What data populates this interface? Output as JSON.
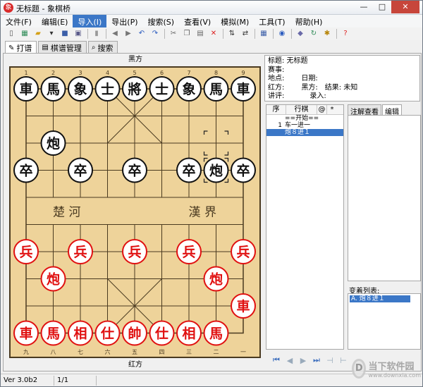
{
  "window": {
    "title": "无标题 - 象棋桥",
    "app_icon": "象",
    "min": "—",
    "max": "□",
    "close": "✕"
  },
  "menu": [
    "文件(F)",
    "编辑(E)",
    "导入(I)",
    "导出(P)",
    "搜索(S)",
    "查看(V)",
    "模拟(M)",
    "工具(T)",
    "帮助(H)"
  ],
  "toolbar": [
    {
      "name": "new-icon",
      "glyph": "▯",
      "color": "#555"
    },
    {
      "name": "board-icon",
      "glyph": "▦",
      "color": "#2e8b57"
    },
    {
      "name": "open-icon",
      "glyph": "▰",
      "color": "#d4a017"
    },
    {
      "name": "dropdown-icon",
      "glyph": "▾",
      "color": "#333"
    },
    {
      "name": "save-icon",
      "glyph": "■",
      "color": "#3b5ea8"
    },
    {
      "name": "save-as-icon",
      "glyph": "▣",
      "color": "#5a5a8a"
    },
    {
      "sep": true
    },
    {
      "name": "delete-icon",
      "glyph": "▮",
      "color": "#999"
    },
    {
      "sep": true
    },
    {
      "name": "back-icon",
      "glyph": "◀",
      "color": "#777"
    },
    {
      "name": "forward-icon",
      "glyph": "▶",
      "color": "#777"
    },
    {
      "name": "undo-icon",
      "glyph": "↶",
      "color": "#2a5bbf"
    },
    {
      "name": "redo-icon",
      "glyph": "↷",
      "color": "#2a5bbf"
    },
    {
      "sep": true
    },
    {
      "name": "cut-icon",
      "glyph": "✂",
      "color": "#666"
    },
    {
      "name": "copy-icon",
      "glyph": "❐",
      "color": "#666"
    },
    {
      "name": "paste-icon",
      "glyph": "▤",
      "color": "#666"
    },
    {
      "name": "clear-icon",
      "glyph": "✕",
      "color": "#d22"
    },
    {
      "sep": true
    },
    {
      "name": "sort-icon",
      "glyph": "⇅",
      "color": "#333"
    },
    {
      "name": "swap-icon",
      "glyph": "⇄",
      "color": "#333"
    },
    {
      "sep": true
    },
    {
      "name": "layout-icon",
      "glyph": "▦",
      "color": "#3b5ea8"
    },
    {
      "sep": true
    },
    {
      "name": "play-icon",
      "glyph": "◉",
      "color": "#2a5bbf"
    },
    {
      "sep": true
    },
    {
      "name": "tag-icon",
      "glyph": "◆",
      "color": "#6a6aa8"
    },
    {
      "name": "refresh-icon",
      "glyph": "↻",
      "color": "#2e8b57"
    },
    {
      "name": "settings-icon",
      "glyph": "✱",
      "color": "#b8860b"
    },
    {
      "sep": true
    },
    {
      "name": "help-icon",
      "glyph": "?",
      "color": "#d22"
    }
  ],
  "tabs": [
    {
      "label": "打谱",
      "icon": "✎",
      "active": true
    },
    {
      "label": "棋谱管理",
      "icon": "▤",
      "active": false
    },
    {
      "label": "搜索",
      "icon": "⌕",
      "active": false
    }
  ],
  "board": {
    "top_label": "黑方",
    "bottom_label": "红方",
    "river_left": "楚  河",
    "river_right": "漢  界",
    "top_numbers": [
      "1",
      "2",
      "3",
      "4",
      "5",
      "6",
      "7",
      "8",
      "9"
    ],
    "bottom_numbers": [
      "九",
      "八",
      "七",
      "六",
      "五",
      "四",
      "三",
      "二",
      "一"
    ],
    "colors": {
      "wood": "#eed39a",
      "line": "#4a3a20",
      "red": "#e01010",
      "black": "#111111"
    },
    "pieces": [
      {
        "t": "車",
        "s": "b",
        "f": 0,
        "r": 0
      },
      {
        "t": "馬",
        "s": "b",
        "f": 1,
        "r": 0
      },
      {
        "t": "象",
        "s": "b",
        "f": 2,
        "r": 0
      },
      {
        "t": "士",
        "s": "b",
        "f": 3,
        "r": 0
      },
      {
        "t": "將",
        "s": "b",
        "f": 4,
        "r": 0
      },
      {
        "t": "士",
        "s": "b",
        "f": 5,
        "r": 0
      },
      {
        "t": "象",
        "s": "b",
        "f": 6,
        "r": 0
      },
      {
        "t": "馬",
        "s": "b",
        "f": 7,
        "r": 0
      },
      {
        "t": "車",
        "s": "b",
        "f": 8,
        "r": 0
      },
      {
        "t": "炮",
        "s": "b",
        "f": 1,
        "r": 2
      },
      {
        "t": "卒",
        "s": "b",
        "f": 0,
        "r": 3
      },
      {
        "t": "卒",
        "s": "b",
        "f": 2,
        "r": 3
      },
      {
        "t": "卒",
        "s": "b",
        "f": 4,
        "r": 3
      },
      {
        "t": "卒",
        "s": "b",
        "f": 6,
        "r": 3
      },
      {
        "t": "炮",
        "s": "b",
        "f": 7,
        "r": 3
      },
      {
        "t": "卒",
        "s": "b",
        "f": 8,
        "r": 3
      },
      {
        "t": "兵",
        "s": "r",
        "f": 0,
        "r": 6
      },
      {
        "t": "兵",
        "s": "r",
        "f": 2,
        "r": 6
      },
      {
        "t": "兵",
        "s": "r",
        "f": 4,
        "r": 6
      },
      {
        "t": "兵",
        "s": "r",
        "f": 6,
        "r": 6
      },
      {
        "t": "兵",
        "s": "r",
        "f": 8,
        "r": 6
      },
      {
        "t": "炮",
        "s": "r",
        "f": 1,
        "r": 7
      },
      {
        "t": "炮",
        "s": "r",
        "f": 7,
        "r": 7
      },
      {
        "t": "車",
        "s": "r",
        "f": 8,
        "r": 8
      },
      {
        "t": "車",
        "s": "r",
        "f": 0,
        "r": 9
      },
      {
        "t": "馬",
        "s": "r",
        "f": 1,
        "r": 9
      },
      {
        "t": "相",
        "s": "r",
        "f": 2,
        "r": 9
      },
      {
        "t": "仕",
        "s": "r",
        "f": 3,
        "r": 9
      },
      {
        "t": "帥",
        "s": "r",
        "f": 4,
        "r": 9
      },
      {
        "t": "仕",
        "s": "r",
        "f": 5,
        "r": 9
      },
      {
        "t": "相",
        "s": "r",
        "f": 6,
        "r": 9
      },
      {
        "t": "馬",
        "s": "r",
        "f": 7,
        "r": 9
      }
    ],
    "markers": [
      {
        "f": 7,
        "r": 2
      },
      {
        "f": 7,
        "r": 3
      }
    ]
  },
  "info": {
    "title_label": "标题: 无标题",
    "event_label": "赛事:",
    "place_label": "地点:",
    "date_label": "日期:",
    "red_label": "红方:",
    "black_label": "黑方:",
    "result_label": "结果: 未知",
    "commentator_label": "讲评:",
    "recorder_label": "录入:"
  },
  "moves": {
    "headers": [
      "序",
      "行棋",
      "@",
      "*"
    ],
    "rows": [
      {
        "num": "",
        "text": "==开始==",
        "sel": false
      },
      {
        "num": "1",
        "text": "车一进一",
        "sel": false
      },
      {
        "num": "",
        "text": "炮８进１",
        "sel": true
      }
    ]
  },
  "annotation": {
    "tabs": [
      "注解查看",
      "编辑"
    ],
    "variations_label": "变着列表:",
    "variations": [
      "A. 炮８进１"
    ]
  },
  "nav": [
    "⏮",
    "◀",
    "▶",
    "⏭",
    "⊣",
    "⊢"
  ],
  "status": {
    "version": "Ver 3.0b2",
    "page": "1/1"
  },
  "watermark": {
    "logo": "D",
    "main": "当下软件园",
    "sub": "www.downxia.com"
  }
}
